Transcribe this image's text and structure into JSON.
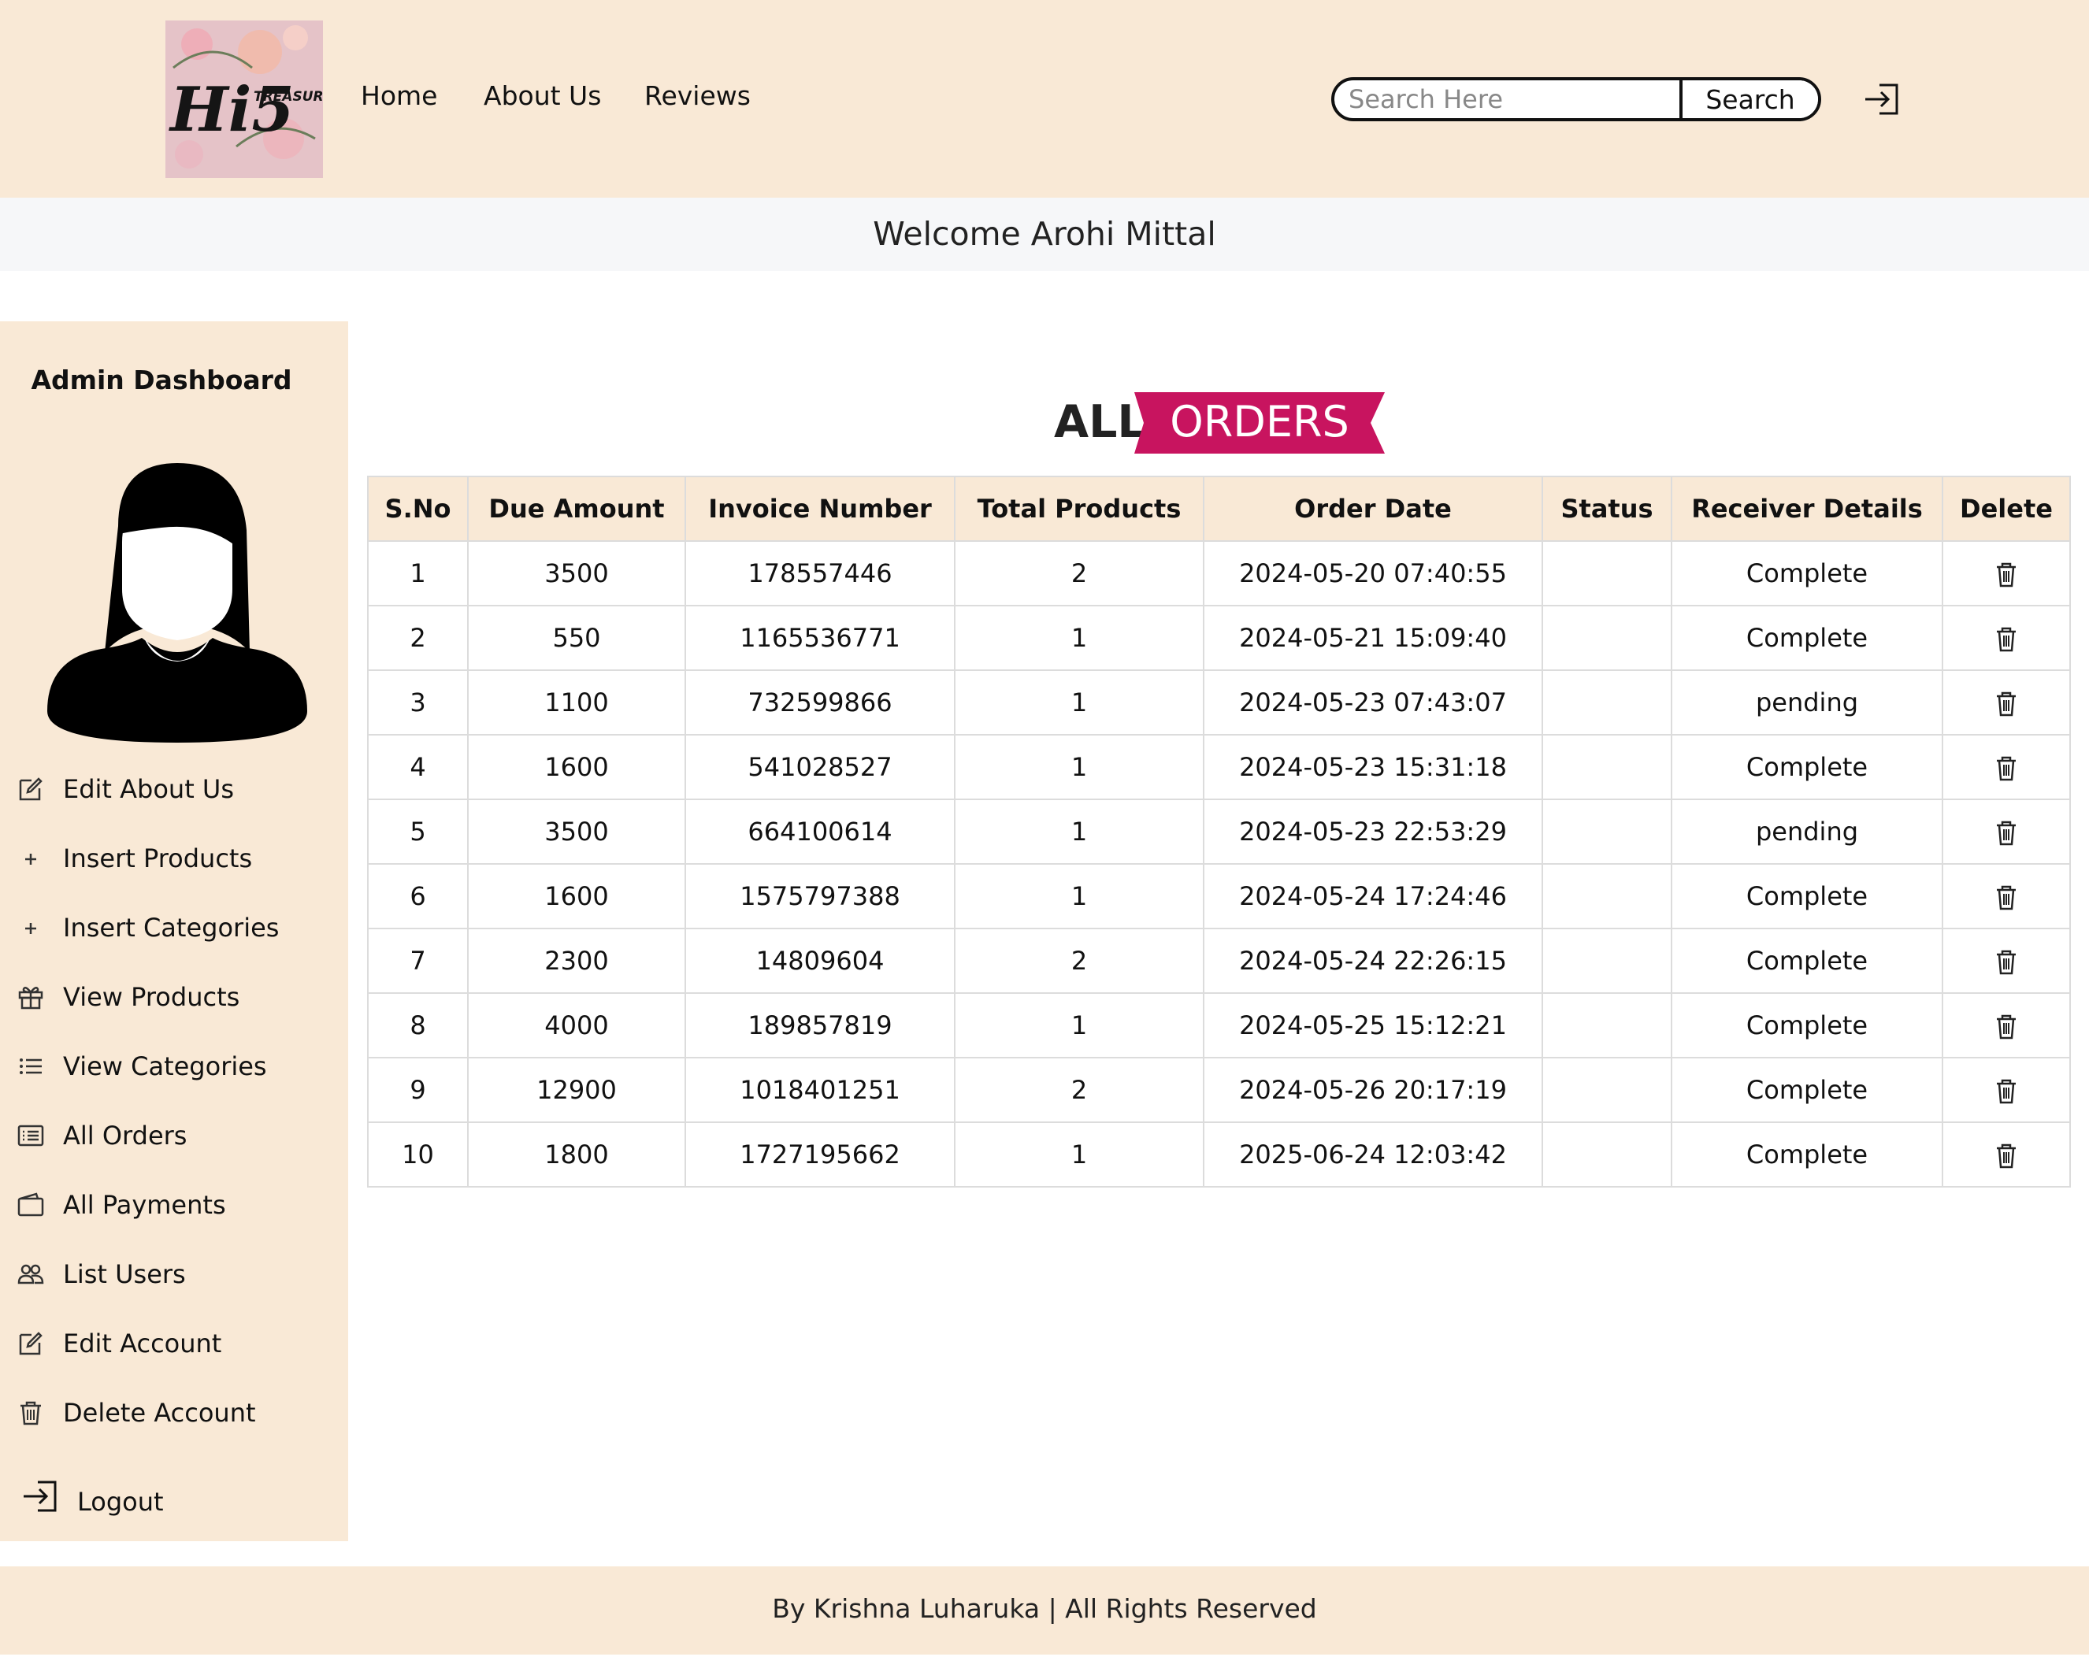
{
  "header": {
    "logo_text": "Hi5",
    "logo_subtext": "TREASURES",
    "nav": [
      {
        "label": "Home"
      },
      {
        "label": "About Us"
      },
      {
        "label": "Reviews"
      }
    ],
    "search": {
      "placeholder": "Search Here",
      "value": "",
      "button_label": "Search"
    },
    "login_icon": "login-icon"
  },
  "welcome": {
    "text": "Welcome Arohi Mittal"
  },
  "sidebar": {
    "title": "Admin Dashboard",
    "avatar_icon": "user-avatar-icon",
    "items": [
      {
        "label": "Edit About Us",
        "icon": "edit-icon"
      },
      {
        "label": "Insert Products",
        "icon": "plus-icon"
      },
      {
        "label": "Insert Categories",
        "icon": "plus-icon"
      },
      {
        "label": "View Products",
        "icon": "gift-icon"
      },
      {
        "label": "View Categories",
        "icon": "list-icon"
      },
      {
        "label": "All Orders",
        "icon": "card-list-icon"
      },
      {
        "label": "All Payments",
        "icon": "wallet-icon"
      },
      {
        "label": "List Users",
        "icon": "people-icon"
      },
      {
        "label": "Edit Account",
        "icon": "edit-icon"
      },
      {
        "label": "Delete Account",
        "icon": "trash-icon"
      }
    ],
    "logout": {
      "label": "Logout",
      "icon": "logout-icon"
    }
  },
  "page_title": {
    "part1": "ALL",
    "part2": "ORDERS",
    "ribbon_color": "#c8145f"
  },
  "table": {
    "headers": [
      "S.No",
      "Due Amount",
      "Invoice Number",
      "Total Products",
      "Order Date",
      "Status",
      "Receiver Details",
      "Delete"
    ],
    "rows": [
      {
        "sno": "1",
        "due": "3500",
        "invoice": "178557446",
        "products": "2",
        "date": "2024-05-20 07:40:55",
        "status": "",
        "receiver": "Complete"
      },
      {
        "sno": "2",
        "due": "550",
        "invoice": "1165536771",
        "products": "1",
        "date": "2024-05-21 15:09:40",
        "status": "",
        "receiver": "Complete"
      },
      {
        "sno": "3",
        "due": "1100",
        "invoice": "732599866",
        "products": "1",
        "date": "2024-05-23 07:43:07",
        "status": "",
        "receiver": "pending"
      },
      {
        "sno": "4",
        "due": "1600",
        "invoice": "541028527",
        "products": "1",
        "date": "2024-05-23 15:31:18",
        "status": "",
        "receiver": "Complete"
      },
      {
        "sno": "5",
        "due": "3500",
        "invoice": "664100614",
        "products": "1",
        "date": "2024-05-23 22:53:29",
        "status": "",
        "receiver": "pending"
      },
      {
        "sno": "6",
        "due": "1600",
        "invoice": "1575797388",
        "products": "1",
        "date": "2024-05-24 17:24:46",
        "status": "",
        "receiver": "Complete"
      },
      {
        "sno": "7",
        "due": "2300",
        "invoice": "14809604",
        "products": "2",
        "date": "2024-05-24 22:26:15",
        "status": "",
        "receiver": "Complete"
      },
      {
        "sno": "8",
        "due": "4000",
        "invoice": "189857819",
        "products": "1",
        "date": "2024-05-25 15:12:21",
        "status": "",
        "receiver": "Complete"
      },
      {
        "sno": "9",
        "due": "12900",
        "invoice": "1018401251",
        "products": "2",
        "date": "2024-05-26 20:17:19",
        "status": "",
        "receiver": "Complete"
      },
      {
        "sno": "10",
        "due": "1800",
        "invoice": "1727195662",
        "products": "1",
        "date": "2025-06-24 12:03:42",
        "status": "",
        "receiver": "Complete"
      }
    ],
    "delete_icon": "trash-icon"
  },
  "footer": {
    "text": "By Krishna Luharuka | All Rights Reserved"
  },
  "colors": {
    "header_bg": "#f9e9d6",
    "welcome_bg": "#f6f7f9",
    "accent": "#c8145f"
  }
}
